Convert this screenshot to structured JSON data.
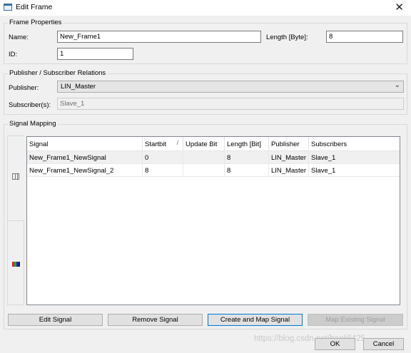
{
  "window": {
    "title": "Edit Frame",
    "close_glyph": "✕"
  },
  "frame_properties": {
    "group_title": "Frame Properties",
    "name_label": "Name:",
    "name_value": "New_Frame1",
    "length_label": "Length [Byte]:",
    "length_value": "8",
    "id_label": "ID:",
    "id_value": "1"
  },
  "relations": {
    "group_title": "Publisher / Subscriber Relations",
    "publisher_label": "Publisher:",
    "publisher_value": "LIN_Master",
    "subscriber_label": "Subscriber(s):",
    "subscriber_value": "Slave_1"
  },
  "signal_mapping": {
    "group_title": "Signal Mapping",
    "side_tab_icons": [
      "grid-view-icon",
      "color-bits-icon"
    ],
    "columns": [
      "Signal",
      "Startbit",
      "Update Bit",
      "Length [Bit]",
      "Publisher",
      "Subscribers"
    ],
    "sort_indicator": "/",
    "rows": [
      {
        "signal": "New_Frame1_NewSignal",
        "startbit": "0",
        "update_bit": "",
        "length": "8",
        "publisher": "LIN_Master",
        "subscribers": "Slave_1"
      },
      {
        "signal": "New_Frame1_NewSignal_2",
        "startbit": "8",
        "update_bit": "",
        "length": "8",
        "publisher": "LIN_Master",
        "subscribers": "Slave_1"
      }
    ]
  },
  "buttons": {
    "edit_signal": "Edit Signal",
    "remove_signal": "Remove Signal",
    "create_map_signal": "Create and Map Signal",
    "map_existing_signal": "Map Existing Signal",
    "ok": "OK",
    "cancel": "Cancel"
  },
  "watermark": "https://blog.csdn.net/baoli8425"
}
